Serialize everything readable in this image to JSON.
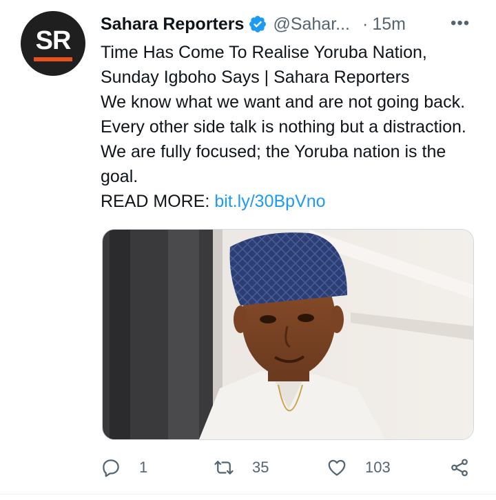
{
  "account": {
    "name": "Sahara Reporters",
    "handle": "@Sahar...",
    "separator": "·",
    "timestamp": "15m",
    "avatar_text": "SR",
    "more_label": "•••",
    "verified_icon": "verified-badge-icon"
  },
  "tweet": {
    "lines": [
      "Time Has Come To Realise Yoruba Nation, Sunday Igboho Says | Sahara Reporters",
      "We know what we want and are not going back. Every other side talk is nothing but a distraction. We are fully focused; the Yoruba nation is the goal."
    ],
    "read_more_label": "READ MORE:",
    "link_text": "bit.ly/30BpVno"
  },
  "actions": {
    "reply_count": "1",
    "retweet_count": "35",
    "like_count": "103"
  },
  "colors": {
    "text": "#0f1419",
    "secondary": "#536471",
    "link": "#1d9bf0",
    "verified": "#1d9bf0",
    "brand_accent": "#e8501c"
  }
}
